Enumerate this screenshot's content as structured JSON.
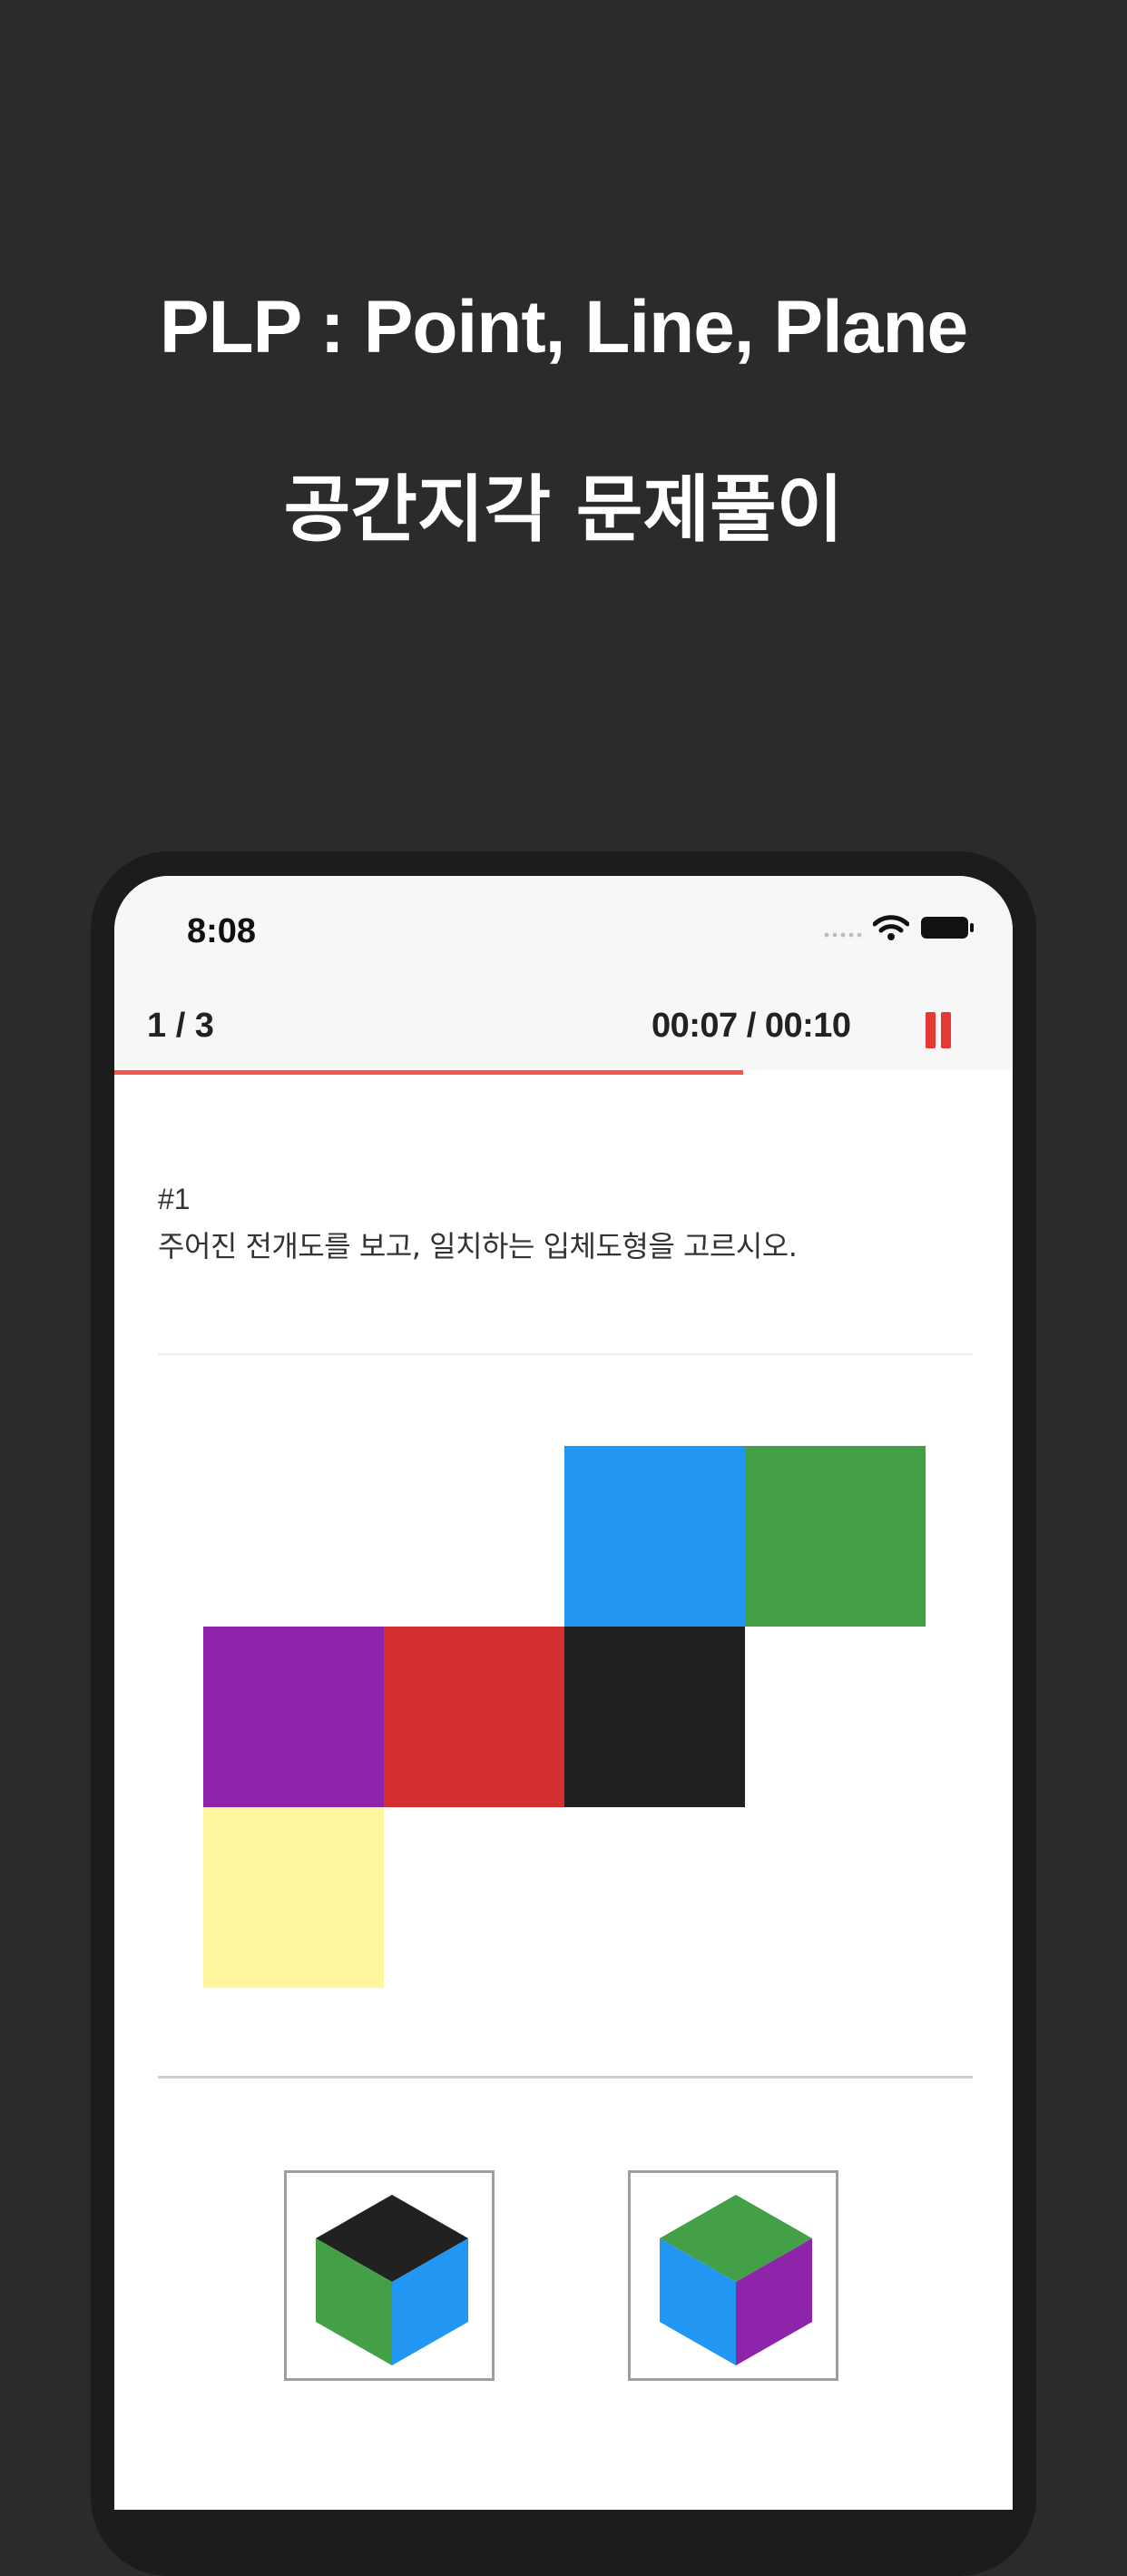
{
  "promo": {
    "title": "PLP : Point, Line, Plane",
    "subtitle": "공간지각 문제풀이"
  },
  "status_bar": {
    "time": "8:08",
    "icons": [
      "signal-icon",
      "wifi-icon",
      "battery-icon"
    ]
  },
  "quiz_header": {
    "progress": "1 / 3",
    "timer": "00:07 / 00:10",
    "elapsed_fraction": 0.7,
    "pause_icon": "pause-icon",
    "accent_color": "#e53935"
  },
  "question": {
    "number": "#1",
    "text": "주어진 전개도를 보고, 일치하는 입체도형을 고르시오."
  },
  "net": {
    "faces": [
      {
        "name": "blue",
        "color": "#2196f3",
        "row": 0,
        "col": 2
      },
      {
        "name": "green",
        "color": "#43a047",
        "row": 0,
        "col": 3
      },
      {
        "name": "purple",
        "color": "#8e24aa",
        "row": 1,
        "col": 0
      },
      {
        "name": "red",
        "color": "#d32f2f",
        "row": 1,
        "col": 1
      },
      {
        "name": "black",
        "color": "#212121",
        "row": 1,
        "col": 2
      },
      {
        "name": "yellow",
        "color": "#fff59d",
        "row": 2,
        "col": 0
      }
    ]
  },
  "choices": [
    {
      "top": "#212121",
      "left": "#43a047",
      "right": "#2196f3"
    },
    {
      "top": "#43a047",
      "left": "#2196f3",
      "right": "#8e24aa"
    }
  ]
}
